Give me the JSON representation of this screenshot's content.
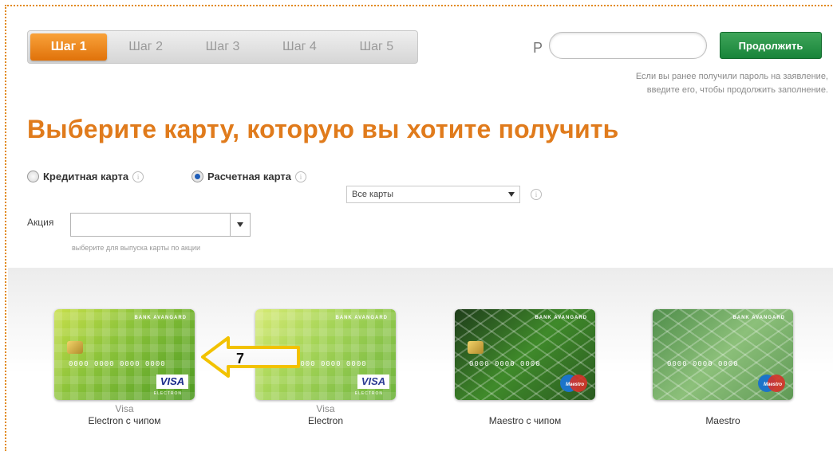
{
  "steps": [
    {
      "label": "Шаг 1",
      "active": true
    },
    {
      "label": "Шаг 2",
      "active": false
    },
    {
      "label": "Шаг 3",
      "active": false
    },
    {
      "label": "Шаг 4",
      "active": false
    },
    {
      "label": "Шаг 5",
      "active": false
    }
  ],
  "password": {
    "label": "P",
    "value": "",
    "button_label": "Продолжить",
    "hint_line1": "Если вы ранее получили пароль на заявление,",
    "hint_line2": "введите его, чтобы продолжить заполнение."
  },
  "title": "Выберите карту, которую вы хотите получить",
  "card_type": {
    "credit_label": "Кредитная карта",
    "debit_label": "Расчетная карта",
    "selected": "debit"
  },
  "filter": {
    "selected": "Все карты"
  },
  "promo": {
    "label": "Акция",
    "value": "",
    "hint": "выберите для выпуска карты по акции"
  },
  "cards": [
    {
      "line1": "Visa",
      "line2": "Electron с чипом",
      "bank": "BANK AVANGARD",
      "number": "0000 0000 0000 0000",
      "logo": "VISA",
      "logo_sub": "ELECTRON"
    },
    {
      "line1": "Visa",
      "line2": "Electron",
      "bank": "BANK AVANGARD",
      "number": "0000 0000 0000 0000",
      "logo": "VISA",
      "logo_sub": "ELECTRON"
    },
    {
      "line1": "",
      "line2": "Maestro с чипом",
      "bank": "BANK AVANGARD",
      "number": "0000 0000 0000",
      "logo": "Maestro"
    },
    {
      "line1": "",
      "line2": "Maestro",
      "bank": "BANK AVANGARD",
      "number": "0000 0000 0000",
      "logo": "Maestro"
    }
  ],
  "annotation": {
    "number": "7"
  },
  "colors": {
    "accent": "#e07b1c",
    "button": "#18843a",
    "step_active": "#f08a1e"
  },
  "icons": {
    "info": "info-circle-icon",
    "dropdown": "chevron-down-icon",
    "callout": "left-arrow-callout-icon"
  }
}
